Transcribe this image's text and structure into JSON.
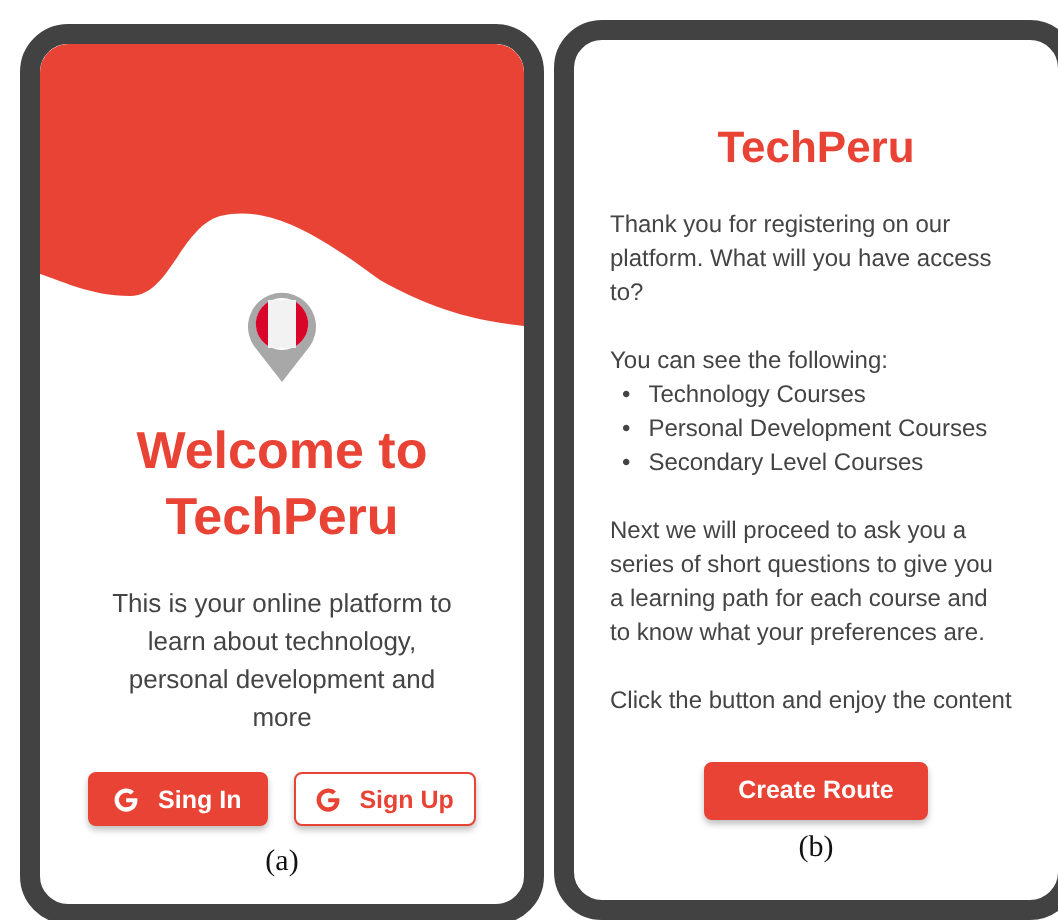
{
  "screens": [
    {
      "kind": "welcome",
      "title_lines": [
        "Welcome to",
        "TechPeru"
      ],
      "description": "This is your online platform to learn about technology, personal development and more",
      "buttons": [
        {
          "label": "Sing In",
          "kind": "filled"
        },
        {
          "label": "Sign Up",
          "kind": "outlined"
        }
      ],
      "caption": "(a)"
    },
    {
      "kind": "info",
      "title": "TechPeru",
      "intro": "Thank you for registering on our platform. What will you have access to?",
      "list_heading": "You can see the following:",
      "items": [
        {
          "bullet": "•",
          "text": "Technology Courses"
        },
        {
          "bullet": "•",
          "text": "Personal Development Courses"
        },
        {
          "bullet": "•",
          "text": "Secondary Level Courses"
        }
      ],
      "next": "Next we will proceed to ask you a series of short questions to give you a learning path for each course and to know what your preferences are.",
      "closing": "Click the button and enjoy the content",
      "button": "Create Route",
      "caption": "(b)"
    }
  ]
}
